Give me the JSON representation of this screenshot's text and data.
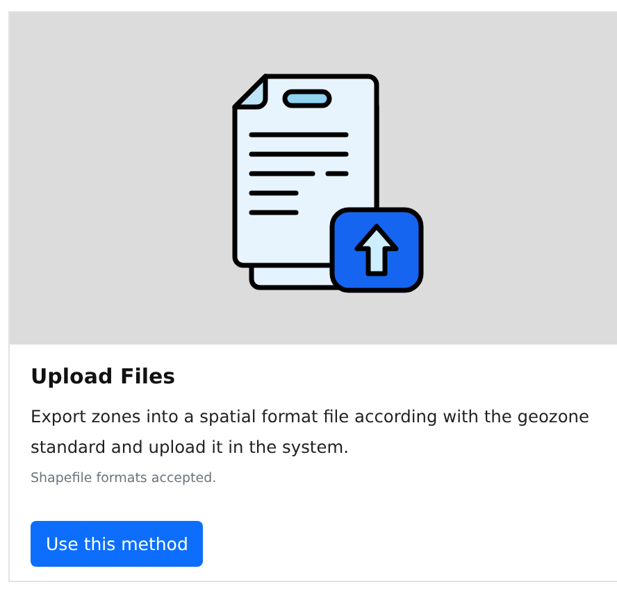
{
  "card": {
    "title": "Upload Files",
    "description": "Export zones into a spatial format file according with the geozone standard and upload it in the system.",
    "note": "Shapefile formats accepted.",
    "button": "Use this method"
  }
}
